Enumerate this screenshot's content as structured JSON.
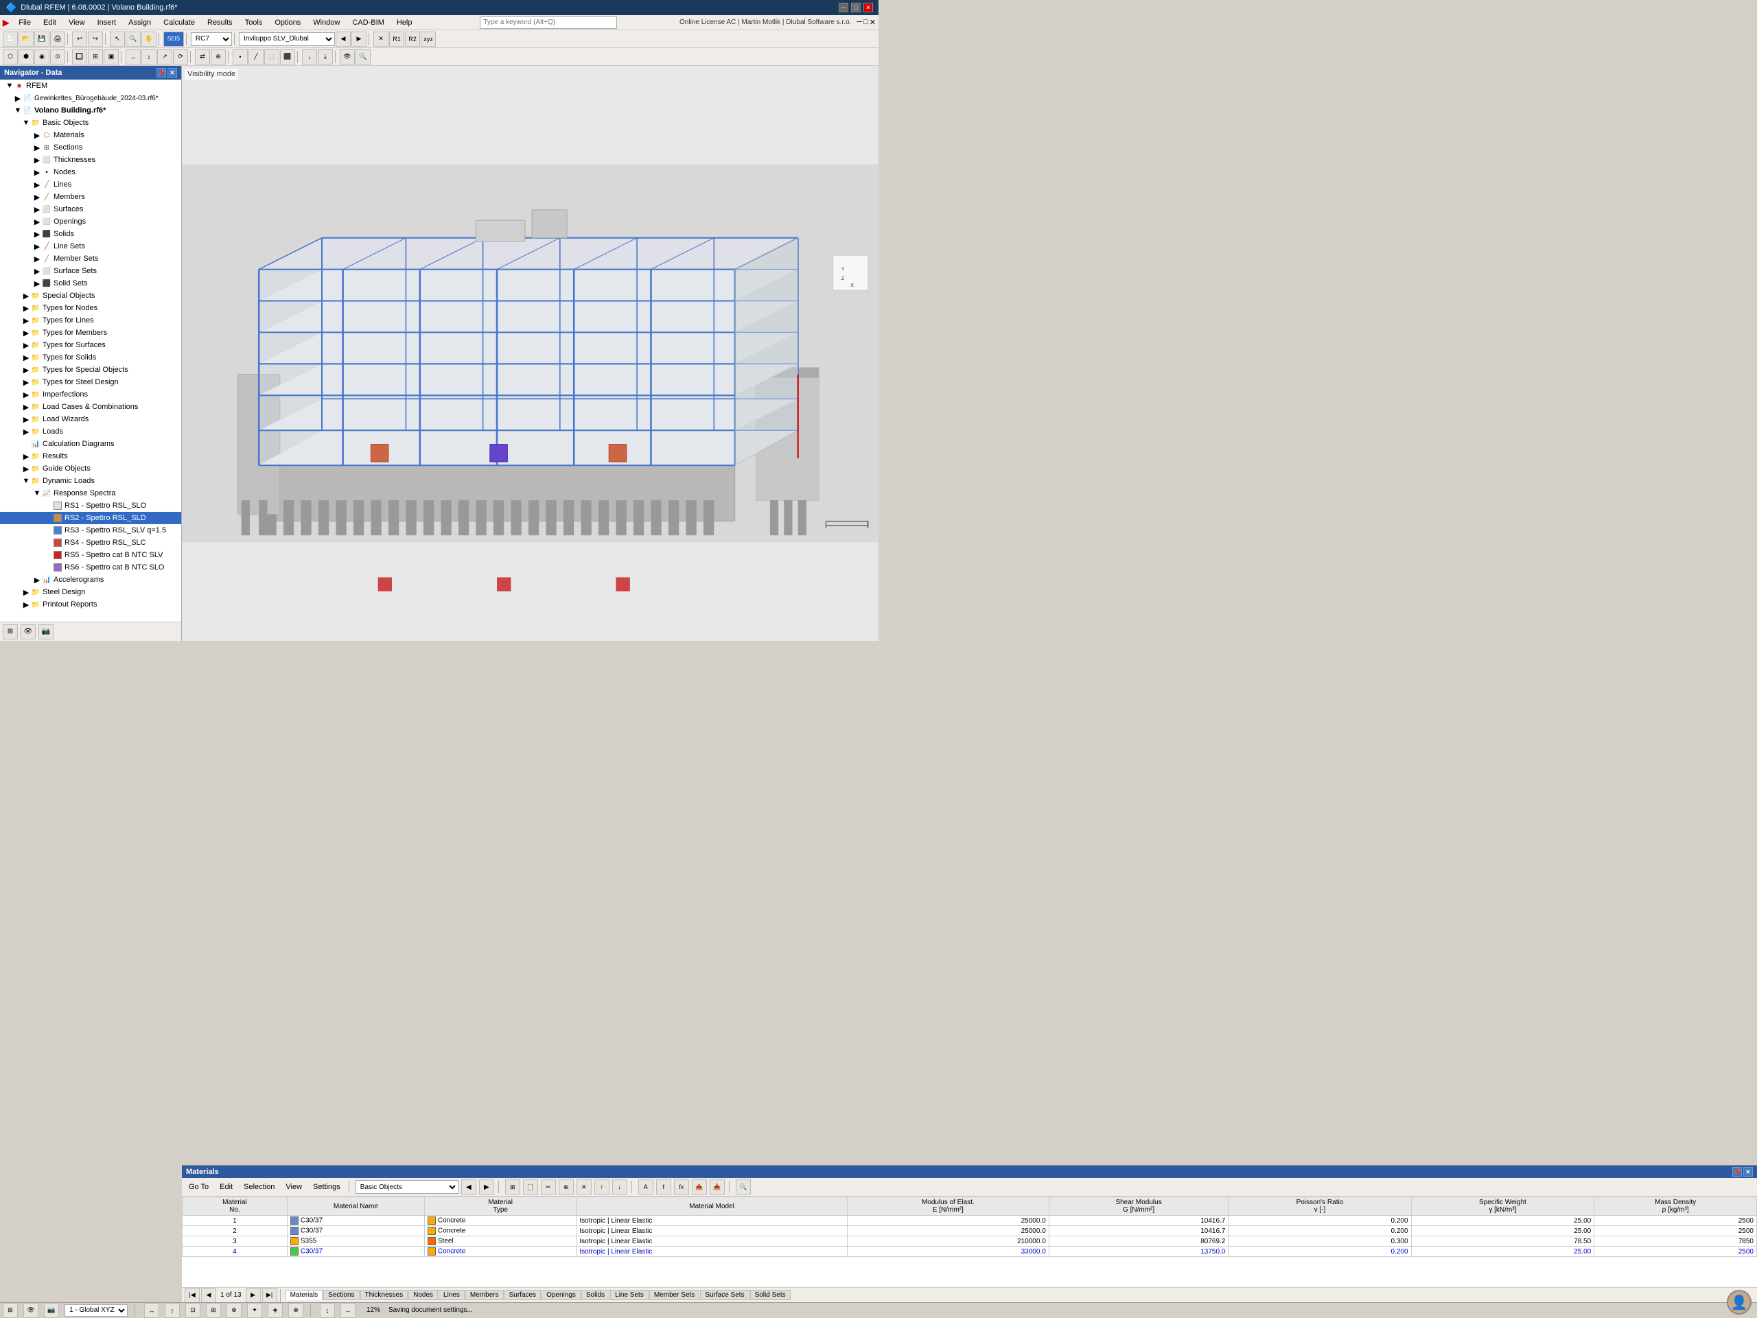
{
  "titlebar": {
    "title": "Dlubal RFEM | 6.08.0002 | Volano Building.rf6*",
    "icon": "dlubal-icon"
  },
  "menubar": {
    "items": [
      "File",
      "Edit",
      "View",
      "Insert",
      "Assign",
      "Calculate",
      "Results",
      "Tools",
      "Options",
      "Window",
      "CAD-BIM",
      "Help"
    ]
  },
  "searchbar": {
    "placeholder": "Type a keyword (Alt+Q)"
  },
  "license": {
    "text": "Online License AC | Martin Motlik | Dlubal Software s.r.o."
  },
  "analysis": {
    "method": "RC7",
    "combination": "Inviluppo SLV_Dlubal"
  },
  "navigator": {
    "title": "Navigator - Data",
    "sections": [
      {
        "label": "RFEM",
        "level": 0,
        "type": "root",
        "expanded": true
      },
      {
        "label": "Gewinkeltes_Bürogebäude_2024-03.rf6*",
        "level": 1,
        "type": "file",
        "expanded": false
      },
      {
        "label": "Volano Building.rf6*",
        "level": 1,
        "type": "file",
        "expanded": true,
        "bold": true
      },
      {
        "label": "Basic Objects",
        "level": 2,
        "type": "folder",
        "expanded": true
      },
      {
        "label": "Materials",
        "level": 3,
        "type": "item"
      },
      {
        "label": "Sections",
        "level": 3,
        "type": "item"
      },
      {
        "label": "Thicknesses",
        "level": 3,
        "type": "item"
      },
      {
        "label": "Nodes",
        "level": 3,
        "type": "item"
      },
      {
        "label": "Lines",
        "level": 3,
        "type": "item"
      },
      {
        "label": "Members",
        "level": 3,
        "type": "item"
      },
      {
        "label": "Surfaces",
        "level": 3,
        "type": "item"
      },
      {
        "label": "Openings",
        "level": 3,
        "type": "item"
      },
      {
        "label": "Solids",
        "level": 3,
        "type": "item"
      },
      {
        "label": "Line Sets",
        "level": 3,
        "type": "item"
      },
      {
        "label": "Member Sets",
        "level": 3,
        "type": "item"
      },
      {
        "label": "Surface Sets",
        "level": 3,
        "type": "item"
      },
      {
        "label": "Solid Sets",
        "level": 3,
        "type": "item"
      },
      {
        "label": "Special Objects",
        "level": 2,
        "type": "folder",
        "expanded": false
      },
      {
        "label": "Types for Nodes",
        "level": 2,
        "type": "folder",
        "expanded": false
      },
      {
        "label": "Types for Lines",
        "level": 2,
        "type": "folder",
        "expanded": false
      },
      {
        "label": "Types for Members",
        "level": 2,
        "type": "folder",
        "expanded": false
      },
      {
        "label": "Types for Surfaces",
        "level": 2,
        "type": "folder",
        "expanded": false
      },
      {
        "label": "Types for Solids",
        "level": 2,
        "type": "folder",
        "expanded": false
      },
      {
        "label": "Types for Special Objects",
        "level": 2,
        "type": "folder",
        "expanded": false
      },
      {
        "label": "Types for Steel Design",
        "level": 2,
        "type": "folder",
        "expanded": false
      },
      {
        "label": "Imperfections",
        "level": 2,
        "type": "folder",
        "expanded": false
      },
      {
        "label": "Load Cases & Combinations",
        "level": 2,
        "type": "folder",
        "expanded": false
      },
      {
        "label": "Load Wizards",
        "level": 2,
        "type": "folder",
        "expanded": false
      },
      {
        "label": "Loads",
        "level": 2,
        "type": "folder",
        "expanded": false
      },
      {
        "label": "Calculation Diagrams",
        "level": 2,
        "type": "item-diag"
      },
      {
        "label": "Results",
        "level": 2,
        "type": "folder",
        "expanded": false
      },
      {
        "label": "Guide Objects",
        "level": 2,
        "type": "folder",
        "expanded": false
      },
      {
        "label": "Dynamic Loads",
        "level": 2,
        "type": "folder",
        "expanded": true
      },
      {
        "label": "Response Spectra",
        "level": 3,
        "type": "folder",
        "expanded": true
      },
      {
        "label": "RS1 - Spettro RSL_SLO",
        "level": 4,
        "type": "rs",
        "color": "#e0e0e0"
      },
      {
        "label": "RS2 - Spettro RSL_SLD",
        "level": 4,
        "type": "rs",
        "color": "#cc8844",
        "highlighted": true
      },
      {
        "label": "RS3 - Spettro RSL_SLV q=1.5",
        "level": 4,
        "type": "rs",
        "color": "#4488cc"
      },
      {
        "label": "RS4 - Spettro RSL_SLC",
        "level": 4,
        "type": "rs",
        "color": "#cc4444"
      },
      {
        "label": "RS5 - Spettro cat B NTC SLV",
        "level": 4,
        "type": "rs",
        "color": "#cc2222"
      },
      {
        "label": "RS6 - Spettro cat B NTC SLO",
        "level": 4,
        "type": "rs",
        "color": "#9966cc"
      },
      {
        "label": "Accelerograms",
        "level": 3,
        "type": "folder",
        "expanded": false
      },
      {
        "label": "Steel Design",
        "level": 2,
        "type": "folder",
        "expanded": false
      },
      {
        "label": "Printout Reports",
        "level": 2,
        "type": "folder",
        "expanded": false
      }
    ]
  },
  "viewport": {
    "label": "Visibility mode"
  },
  "materials_panel": {
    "title": "Materials",
    "goto_label": "Go To",
    "edit_label": "Edit",
    "selection_label": "Selection",
    "view_label": "View",
    "settings_label": "Settings",
    "basic_objects": "Basic Objects",
    "nav_info": "1 of 13",
    "columns": [
      "Material No.",
      "Material Name",
      "Material Type",
      "Material Model",
      "Modulus of Elast. E [N/mm²]",
      "Shear Modulus G [N/mm²]",
      "Poisson's Ratio v [-]",
      "Specific Weight γ [kN/m³]",
      "Mass Density ρ [kg/m³]"
    ],
    "rows": [
      {
        "no": "1",
        "name": "C30/37",
        "type": "Concrete",
        "model": "Isotropic | Linear Elastic",
        "E": "25000.0",
        "G": "10416.7",
        "v": "0.200",
        "gamma": "25.00",
        "rho": "2500",
        "color": "#6688cc",
        "typeColor": "#ffaa00"
      },
      {
        "no": "2",
        "name": "C30/37",
        "type": "Concrete",
        "model": "Isotropic | Linear Elastic",
        "E": "25000.0",
        "G": "10416.7",
        "v": "0.200",
        "gamma": "25.00",
        "rho": "2500",
        "color": "#6688cc",
        "typeColor": "#ffaa00"
      },
      {
        "no": "3",
        "name": "S355",
        "type": "Steel",
        "model": "Isotropic | Linear Elastic",
        "E": "210000.0",
        "G": "80769.2",
        "v": "0.300",
        "gamma": "78.50",
        "rho": "7850",
        "color": "#ffaa00",
        "typeColor": "#ff6600"
      },
      {
        "no": "4",
        "name": "C30/37",
        "type": "Concrete",
        "model": "Isotropic | Linear Elastic",
        "E": "33000.0",
        "G": "13750.0",
        "v": "0.200",
        "gamma": "25.00",
        "rho": "2500",
        "color": "#44cc44",
        "typeColor": "#ffaa00",
        "highlighted": true
      }
    ],
    "footer_tabs": [
      "Materials",
      "Sections",
      "Thicknesses",
      "Nodes",
      "Lines",
      "Members",
      "Surfaces",
      "Openings",
      "Solids",
      "Line Sets",
      "Member Sets",
      "Surface Sets",
      "Solid Sets"
    ]
  },
  "statusbar": {
    "coordinate_system": "1 - Global XYZ",
    "zoom": "12%",
    "status_text": "Saving document settings..."
  },
  "icons": {
    "folder": "📁",
    "expand": "▶",
    "collapse": "▼",
    "file": "📄",
    "minus": "─"
  }
}
